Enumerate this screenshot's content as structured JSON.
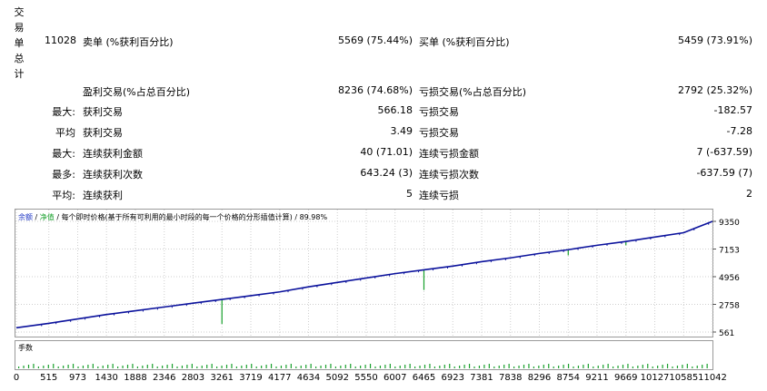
{
  "report": {
    "total_trades_label": "交易单总计",
    "total_trades_value": "11028",
    "short_label": "卖单 (%获利百分比)",
    "short_value": "5569 (75.44%)",
    "long_label": "买单 (%获利百分比)",
    "long_value": "5459 (73.91%)",
    "profit_trades_label": "盈利交易(%占总百分比)",
    "profit_trades_value": "8236 (74.68%)",
    "loss_trades_label": "亏损交易(%占总百分比)",
    "loss_trades_value": "2792 (25.32%)",
    "rows": [
      {
        "prefix": "最大:",
        "l_label": "获利交易",
        "l_value": "566.18",
        "r_label": "亏损交易",
        "r_value": "-182.57"
      },
      {
        "prefix": "平均",
        "l_label": "获利交易",
        "l_value": "3.49",
        "r_label": "亏损交易",
        "r_value": "-7.28"
      },
      {
        "prefix": "最大:",
        "l_label": "连续获利金额",
        "l_value": "40 (71.01)",
        "r_label": "连续亏损金额",
        "r_value": "7 (-637.59)"
      },
      {
        "prefix": "最多:",
        "l_label": "连续获利次数",
        "l_value": "643.24 (3)",
        "r_label": "连续亏损次数",
        "r_value": "-637.59 (7)"
      },
      {
        "prefix": "平均:",
        "l_label": "连续获利",
        "l_value": "5",
        "r_label": "连续亏损",
        "r_value": "2"
      }
    ]
  },
  "chart": {
    "legend_balance": "余额",
    "legend_sep1": " / ",
    "legend_equity": "净值",
    "legend_rest": " / 每个即时价格(基于所有可利用的最小时段的每一个价格的分形插值计算) / 89.98%",
    "volume_label": "手数",
    "colors": {
      "balance": "#0b129c",
      "equity": "#17a02b",
      "legend_balance": "#1e35c4",
      "legend_equity": "#17a02b",
      "border": "#9a9a9a"
    }
  },
  "chart_data": {
    "type": "line",
    "title": "",
    "y_ticks": [
      "9350",
      "7153",
      "4956",
      "2758",
      "561"
    ],
    "x_ticks": [
      "0",
      "515",
      "973",
      "1430",
      "1888",
      "2346",
      "2803",
      "3261",
      "3719",
      "4177",
      "4634",
      "5092",
      "5550",
      "6007",
      "6465",
      "6923",
      "7381",
      "7838",
      "8296",
      "8754",
      "9211",
      "9669",
      "10127",
      "10585",
      "11042"
    ],
    "xlim": [
      0,
      11042
    ],
    "ylim": [
      561,
      9350
    ],
    "series": [
      {
        "name": "余额",
        "x": [
          0,
          515,
          973,
          1430,
          1888,
          2346,
          2803,
          3261,
          3719,
          4177,
          4634,
          5092,
          5550,
          6007,
          6465,
          6923,
          7381,
          7838,
          8296,
          8754,
          9211,
          9669,
          10127,
          10585,
          11042
        ],
        "values": [
          900,
          1250,
          1600,
          1950,
          2250,
          2550,
          2850,
          3150,
          3450,
          3750,
          4150,
          4500,
          4850,
          5200,
          5500,
          5800,
          6150,
          6450,
          6800,
          7100,
          7450,
          7750,
          8100,
          8450,
          9350
        ]
      },
      {
        "name": "净值",
        "x": [
          3261,
          6465,
          8754,
          9669,
          10585
        ],
        "values": [
          1200,
          3900,
          6650,
          7450,
          8450
        ]
      }
    ]
  }
}
